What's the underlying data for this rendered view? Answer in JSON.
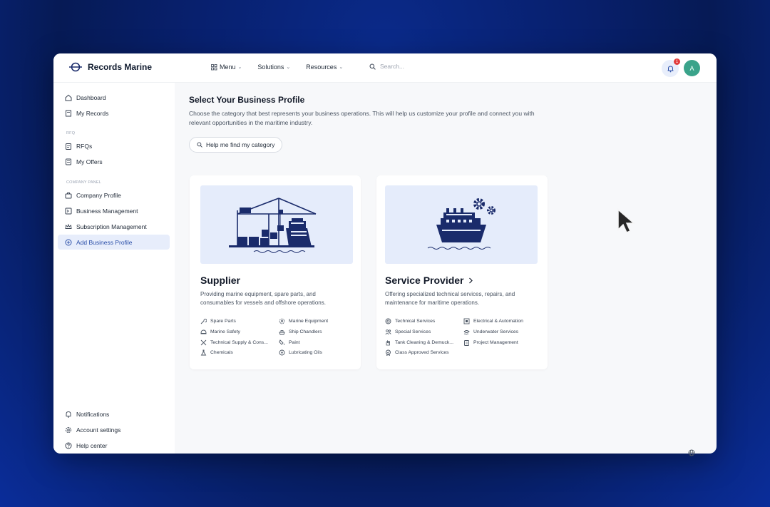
{
  "brand": {
    "name": "Records Marine"
  },
  "nav": {
    "menu": "Menu",
    "solutions": "Solutions",
    "resources": "Resources",
    "search_placeholder": "Search..."
  },
  "notifications": {
    "count": "1"
  },
  "user": {
    "initial": "A"
  },
  "sidebar": {
    "dashboard": "Dashboard",
    "my_records": "My Records",
    "section_rfq": "RFQ",
    "rfqs": "RFQs",
    "my_offers": "My Offers",
    "section_company": "COMPANY PANEL",
    "company_profile": "Company Profile",
    "business_management": "Business Management",
    "subscription_management": "Subscription Management",
    "add_business_profile": "Add Business Profile",
    "notifications": "Notifications",
    "account_settings": "Account settings",
    "help_center": "Help center"
  },
  "main": {
    "title": "Select Your Business Profile",
    "description": "Choose the category that best represents your business operations. This will help us customize your profile and connect you with relevant opportunities in the maritime industry.",
    "help_button": "Help me find my category"
  },
  "cards": {
    "supplier": {
      "title": "Supplier",
      "description": "Providing marine equipment, spare parts, and consumables for vessels and offshore operations.",
      "tags": [
        "Spare Parts",
        "Marine Equipment",
        "Marine Safety",
        "Ship Chandlers",
        "Technical Supply & Cons...",
        "Paint",
        "Chemicals",
        "Lubricating Oils"
      ]
    },
    "service_provider": {
      "title": "Service Provider",
      "description": "Offering specialized technical services, repairs, and maintenance for maritime operations.",
      "tags": [
        "Technical Services",
        "Electrical & Automation",
        "Special Services",
        "Underwater Services",
        "Tank Cleaning & Demuck...",
        "Project Management",
        "Class Approved Services"
      ]
    }
  },
  "colors": {
    "accent": "#2b4fa8",
    "navy": "#1a2b6b",
    "card_image_bg": "#e5ecfb"
  }
}
